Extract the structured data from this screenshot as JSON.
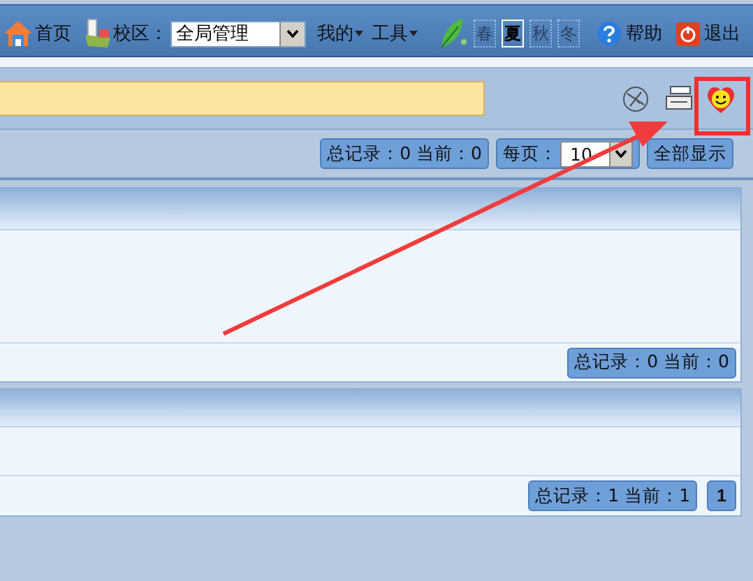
{
  "toolbar": {
    "home": "首页",
    "campus_label": "校区：",
    "campus_value": "全局管理",
    "menus": [
      {
        "label": "我的"
      },
      {
        "label": "工具"
      }
    ],
    "seasons": [
      {
        "label": "春",
        "selected": false
      },
      {
        "label": "夏",
        "selected": true
      },
      {
        "label": "秋",
        "selected": false
      },
      {
        "label": "冬",
        "selected": false
      }
    ],
    "help": "帮助",
    "logout": "退出"
  },
  "pager": {
    "summary": "总记录：0 当前：0",
    "page_size_label": "每页：",
    "page_size": "10",
    "show_all": "全部显示"
  },
  "panels": [
    {
      "summary": "总记录：0 当前：0"
    },
    {
      "summary": "总记录：1 当前：1",
      "pages": [
        {
          "label": "1",
          "selected": true
        }
      ]
    }
  ]
}
